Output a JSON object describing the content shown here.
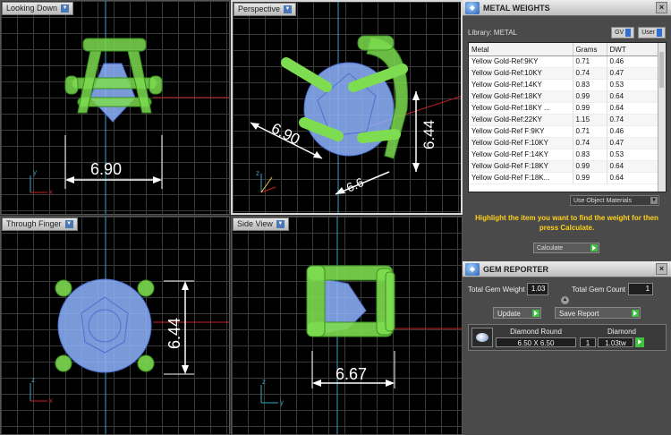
{
  "viewports": {
    "top_left": {
      "label": "Looking Down",
      "dimension": "6.90"
    },
    "top_right": {
      "label": "Perspective",
      "dimension_a": "6.90",
      "dimension_b": "6.44",
      "dimension_c": "6.6"
    },
    "bottom_left": {
      "label": "Through Finger",
      "dimension": "6.44"
    },
    "bottom_right": {
      "label": "Side View",
      "dimension": "6.67"
    },
    "axis": {
      "x": "x",
      "y": "y",
      "z": "z"
    }
  },
  "metal_weights": {
    "title": "METAL WEIGHTS",
    "library_label": "Library: METAL",
    "gv_label": "GV",
    "user_label": "User",
    "columns": [
      "Metal",
      "Grams",
      "DWT"
    ],
    "rows": [
      [
        "Yellow Gold-Ref:9KY",
        "0.71",
        "0.46"
      ],
      [
        "Yellow Gold-Ref:10KY",
        "0.74",
        "0.47"
      ],
      [
        "Yellow Gold-Ref:14KY",
        "0.83",
        "0.53"
      ],
      [
        "Yellow Gold-Ref:18KY",
        "0.99",
        "0.64"
      ],
      [
        "Yellow Gold-Ref:18KY ...",
        "0.99",
        "0.64"
      ],
      [
        "Yellow Gold-Ref:22KY",
        "1.15",
        "0.74"
      ],
      [
        "Yellow Gold-Ref F:9KY",
        "0.71",
        "0.46"
      ],
      [
        "Yellow Gold-Ref F:10KY",
        "0.74",
        "0.47"
      ],
      [
        "Yellow Gold-Ref F:14KY",
        "0.83",
        "0.53"
      ],
      [
        "Yellow Gold-Ref F:18KY",
        "0.99",
        "0.64"
      ],
      [
        "Yellow Gold-Ref F:18K...",
        "0.99",
        "0.64"
      ]
    ],
    "use_object_materials": "Use Object Materials",
    "hint": "Highlight the item you want to find the weight for then press Calculate.",
    "calculate_label": "Calculate"
  },
  "gem_reporter": {
    "title": "GEM REPORTER",
    "total_weight_label": "Total Gem Weight",
    "total_weight_value": "1.03",
    "total_count_label": "Total Gem Count",
    "total_count_value": "1",
    "update_label": "Update",
    "save_report_label": "Save Report",
    "gem": {
      "shape": "Diamond Round",
      "size": "6.50 X 6.50",
      "type": "Diamond",
      "count": "1",
      "weight": "1.03tw"
    }
  },
  "colors": {
    "prong_green": "#7ddc4f",
    "gem_blue": "#8fb4ff",
    "hint_yellow": "#ffd21a",
    "go_green": "#3fc040"
  }
}
